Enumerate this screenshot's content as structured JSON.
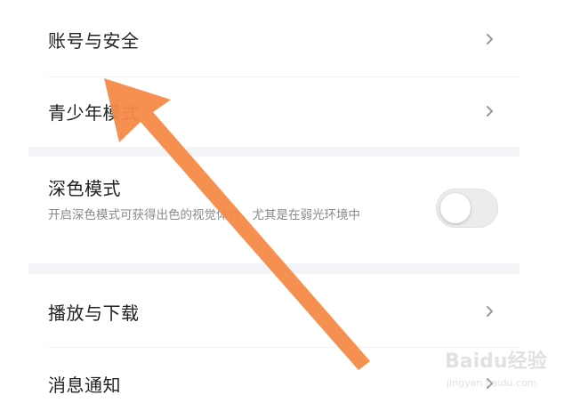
{
  "settings": {
    "account_security": {
      "label": "账号与安全"
    },
    "youth_mode": {
      "label": "青少年模式"
    },
    "dark_mode": {
      "title": "深色模式",
      "description": "开启深色模式可获得出色的视觉体验，尤其是在弱光环境中",
      "enabled": false
    },
    "playback_download": {
      "label": "播放与下载"
    },
    "notifications": {
      "label": "消息通知"
    }
  },
  "icons": {
    "chevron": "chevron-right-icon",
    "arrow": "orange-arrow-annotation"
  },
  "colors": {
    "arrow": "#f58a47",
    "band": "#f2f4f7",
    "chevron": "#9a9a9a"
  },
  "watermark": {
    "brand": "Baidu经验",
    "url": "jingyan.baidu.com"
  }
}
